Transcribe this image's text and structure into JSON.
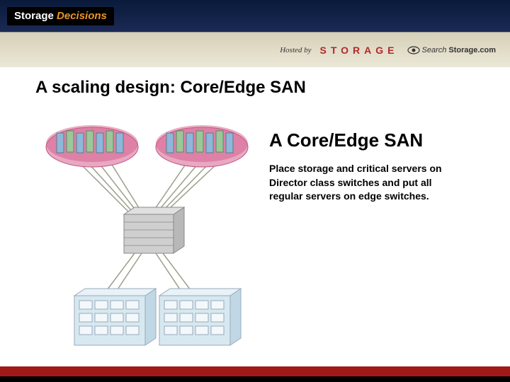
{
  "header": {
    "logo_word1": "Storage",
    "logo_word2": "Decisions"
  },
  "subheader": {
    "hosted_label": "Hosted by",
    "brand1": "STORAGE",
    "brand2_prefix": "Search",
    "brand2_suffix": "Storage.com"
  },
  "slide": {
    "title": "A scaling design: Core/Edge SAN",
    "section_title": "A Core/Edge SAN",
    "body": "Place storage and critical servers on Director class switches and put all regular servers on edge switches."
  },
  "diagram": {
    "layers": {
      "top": "edge server pools",
      "middle": "director switches",
      "bottom": "storage arrays"
    },
    "colors": {
      "pool": "#d45a8a",
      "server_blue": "#8fb8d8",
      "server_green": "#9ac89a",
      "switch_body": "#cfcfcf",
      "storage_body": "#d8e8f0",
      "cable": "#9aa088"
    }
  }
}
